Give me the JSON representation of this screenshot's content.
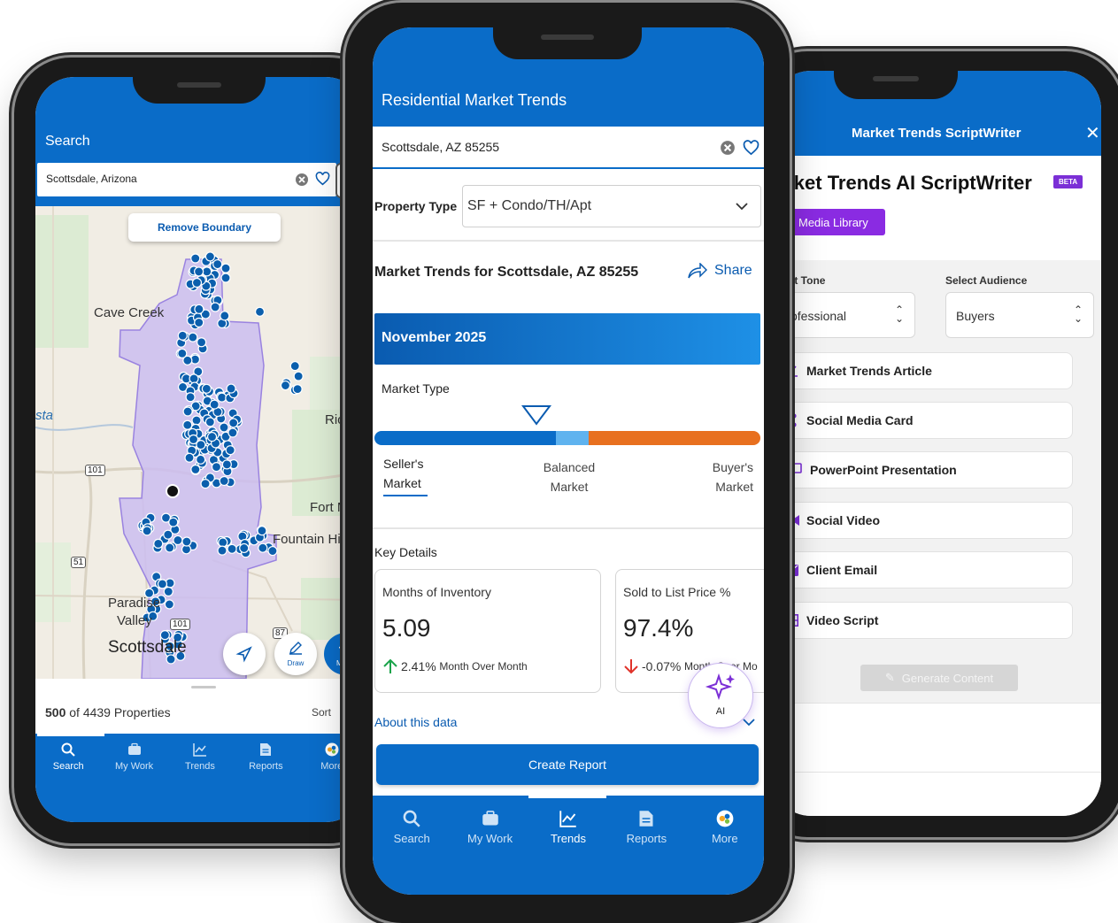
{
  "left_phone": {
    "header_title": "Search",
    "search_value": "Scottsdale, Arizona",
    "remove_boundary_label": "Remove Boundary",
    "map_labels": {
      "cave_creek": "Cave Creek",
      "rio": "Rio",
      "sta": "sta",
      "fort": "Fort M",
      "fountain": "Fountain Hil",
      "paradise": "Paradise",
      "valley": "Valley",
      "scottsdale": "Scottsdale",
      "hwy_101a": "101",
      "hwy_101b": "101",
      "hwy_51": "51",
      "hwy_87": "87"
    },
    "draw_label": "Draw",
    "more_fab_label": "Mo",
    "count_bold": "500",
    "count_rest": " of 4439 Properties",
    "sort_label": "Sort",
    "nav": [
      "Search",
      "My Work",
      "Trends",
      "Reports",
      "More"
    ],
    "colors": {
      "boundary_fill": "#cbbdf0",
      "marker": "#0b5fad"
    }
  },
  "center_phone": {
    "header_title": "Residential Market Trends",
    "search_value": "Scottsdale, AZ 85255",
    "property_type_label": "Property Type",
    "property_type_value": "SF + Condo/TH/Apt",
    "trends_title": "Market Trends for Scottsdale, AZ 85255",
    "share_label": "Share",
    "month_label": "November 2025",
    "market_type_label": "Market Type",
    "market_types": {
      "seller_1": "Seller's",
      "seller_2": "Market",
      "balanced_1": "Balanced",
      "balanced_2": "Market",
      "buyer_1": "Buyer's",
      "buyer_2": "Market"
    },
    "key_details_label": "Key Details",
    "card1": {
      "title": "Months of Inventory",
      "value": "5.09",
      "change": "2.41%",
      "change_suffix": "Month Over Month"
    },
    "card2": {
      "title": "Sold to List Price %",
      "value": "97.4%",
      "change": "-0.07%",
      "change_suffix": "Month Over Mo"
    },
    "ai_label": "AI",
    "about_label": "About this data",
    "create_report_label": "Create Report",
    "nav": [
      "Search",
      "My Work",
      "Trends",
      "Reports",
      "More"
    ],
    "colors": {
      "seller": "#0a6cc8",
      "balanced": "#5fb3ef",
      "buyer": "#e8701f",
      "up": "#1aa34a",
      "down": "#e0332a"
    }
  },
  "right_phone": {
    "header_title": "Market Trends ScriptWriter",
    "big_title": "arket Trends AI ScriptWriter",
    "beta_label": "BETA",
    "media_library_label": "Media Library",
    "tone_label": "elect Tone",
    "tone_value": "Professional",
    "audience_label": "Select Audience",
    "audience_value": "Buyers",
    "options": [
      {
        "label": "Market Trends Article",
        "icon": "chart-line-icon"
      },
      {
        "label": "Social Media Card",
        "icon": "share-nodes-icon"
      },
      {
        "label": "PowerPoint Presentation",
        "icon": "presentation-icon"
      },
      {
        "label": "Social Video",
        "icon": "video-camera-icon"
      },
      {
        "label": "Client Email",
        "icon": "envelope-icon"
      },
      {
        "label": "Video Script",
        "icon": "film-icon"
      }
    ],
    "generate_label": "Generate Content",
    "colors": {
      "accent": "#7b2fd6"
    }
  }
}
